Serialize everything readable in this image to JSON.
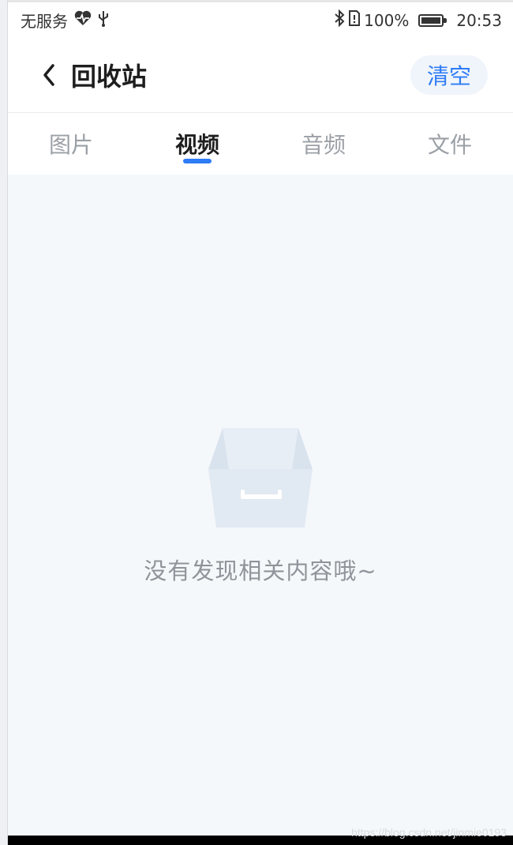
{
  "status_bar": {
    "carrier": "无服务",
    "battery_percent": "100%",
    "time": "20:53"
  },
  "header": {
    "title": "回收站",
    "clear_label": "清空"
  },
  "tabs": [
    {
      "label": "图片",
      "active": false
    },
    {
      "label": "视频",
      "active": true
    },
    {
      "label": "音频",
      "active": false
    },
    {
      "label": "文件",
      "active": false
    }
  ],
  "empty_state": {
    "message": "没有发现相关内容哦~"
  },
  "watermark": "https://blog.csdn.net/jinmie0193",
  "colors": {
    "accent": "#2e7cf6",
    "page_bg": "#f5f8fb",
    "muted_text": "#8f949a"
  },
  "icons": {
    "back": "chevron-left-icon",
    "empty": "empty-box-icon"
  }
}
